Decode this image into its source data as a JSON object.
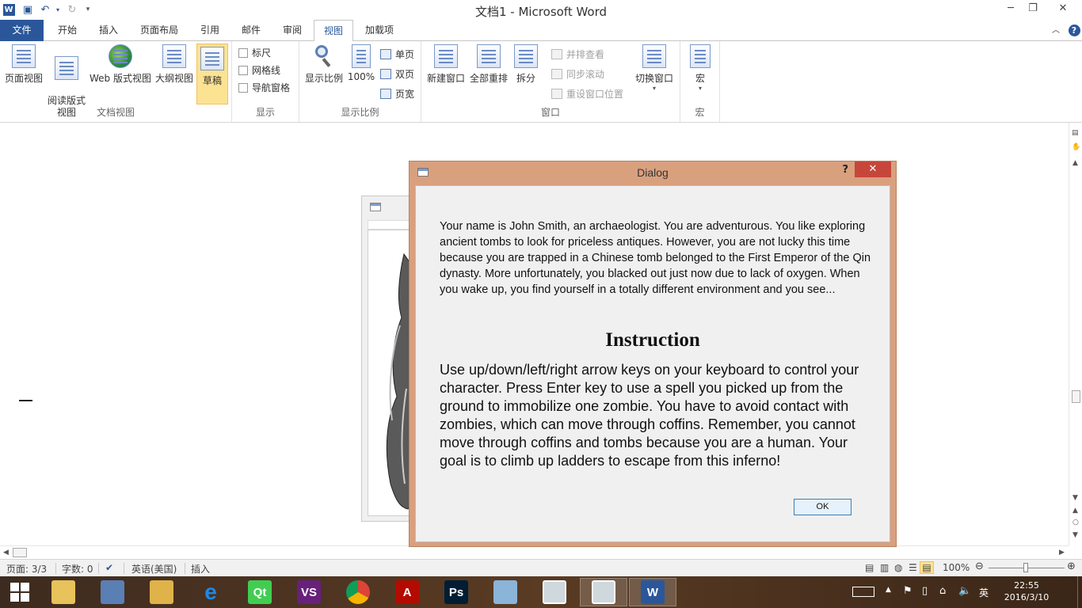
{
  "window": {
    "title": "文档1 - Microsoft Word",
    "help": "?",
    "minimize": "─",
    "restore": "❐",
    "close": "✕"
  },
  "tabs": [
    {
      "label": "文件"
    },
    {
      "label": "开始"
    },
    {
      "label": "插入"
    },
    {
      "label": "页面布局"
    },
    {
      "label": "引用"
    },
    {
      "label": "邮件"
    },
    {
      "label": "审阅"
    },
    {
      "label": "视图"
    },
    {
      "label": "加载项"
    }
  ],
  "ribbon": {
    "doc_views": {
      "label": "文档视图",
      "buttons": [
        {
          "label": "页面视图"
        },
        {
          "label": "阅读版式\n视图"
        },
        {
          "label": "Web 版式视图"
        },
        {
          "label": "大纲视图"
        },
        {
          "label": "草稿"
        }
      ]
    },
    "show": {
      "label": "显示",
      "items": [
        {
          "label": "标尺"
        },
        {
          "label": "网格线"
        },
        {
          "label": "导航窗格"
        }
      ]
    },
    "zoom": {
      "label": "显示比例",
      "zoom_btn": "显示比例",
      "hundred": "100%",
      "one_page": "单页",
      "two_pages": "双页",
      "page_width": "页宽"
    },
    "window": {
      "label": "窗口",
      "new_window": "新建窗口",
      "arrange_all": "全部重排",
      "split": "拆分",
      "side_by_side": "并排查看",
      "sync_scroll": "同步滚动",
      "reset_pos": "重设窗口位置",
      "switch": "切换窗口"
    },
    "macros": {
      "label": "宏",
      "macro_btn": "宏"
    }
  },
  "dialog": {
    "title": "Dialog",
    "help": "?",
    "close": "✕",
    "story": "Your name is John Smith, an archaeologist. You are adventurous. You like exploring ancient tombs to look for priceless antiques. However, you are not lucky this time because you are trapped in a Chinese tomb belonged to the First Emperor of the Qin dynasty. More unfortunately, you blacked out just now due to lack of oxygen. When you wake up, you find yourself in a totally different environment and you see...",
    "instruction_title": "Instruction",
    "instruction_body": "Use up/down/left/right arrow keys on your keyboard to control your character. Press Enter key to use a spell you picked up from the ground to immobilize one zombie. You have to avoid contact with zombies, which can move through coffins. Remember, you cannot move through coffins and tombs because you are a human. Your goal is to climb up ladders to escape from this inferno!",
    "ok": "OK"
  },
  "statusbar": {
    "page": "页面: 3/3",
    "words": "字数: 0",
    "language": "英语(美国)",
    "mode": "插入",
    "zoom": "100%"
  },
  "taskbar": {
    "ime": "英",
    "time": "22:55",
    "date": "2016/3/10",
    "apps": [
      {
        "icon": "file-explorer-icon",
        "color": "#e8c25a"
      },
      {
        "icon": "calculator-icon",
        "color": "#5a7fb5"
      },
      {
        "icon": "folder-icon",
        "color": "#e0b24a"
      },
      {
        "icon": "internet-explorer-icon",
        "color": "#1e88e5",
        "glyph": "e"
      },
      {
        "icon": "qt-creator-icon",
        "color": "#41cd52",
        "glyph": "Qt"
      },
      {
        "icon": "visual-studio-icon",
        "color": "#68217a",
        "glyph": "VS"
      },
      {
        "icon": "chrome-icon",
        "color": "#db4437"
      },
      {
        "icon": "acrobat-icon",
        "color": "#b30b00",
        "glyph": "A"
      },
      {
        "icon": "photoshop-icon",
        "color": "#001d34",
        "glyph": "Ps"
      },
      {
        "icon": "paint-icon",
        "color": "#8ab4d8"
      },
      {
        "icon": "qt-app-window-icon",
        "color": "#cfd8dc"
      },
      {
        "icon": "qt-app-window-icon",
        "color": "#cfd8dc"
      },
      {
        "icon": "word-icon",
        "color": "#2b579a",
        "glyph": "W"
      }
    ]
  }
}
